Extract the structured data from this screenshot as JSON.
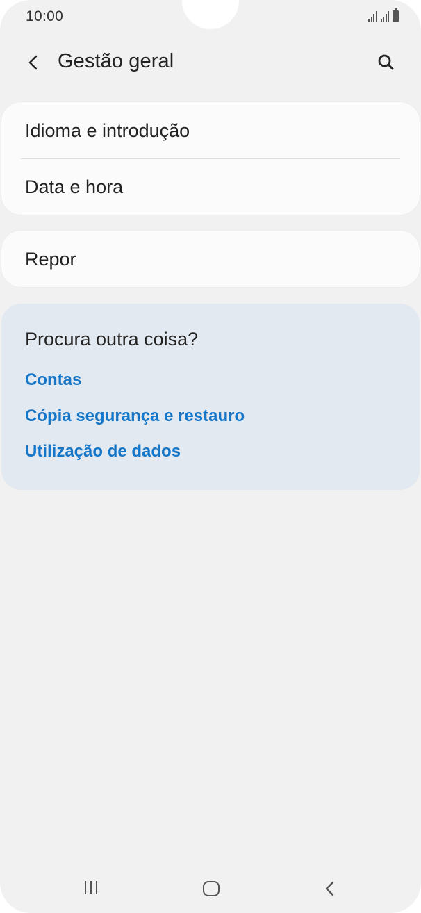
{
  "status_bar": {
    "time": "10:00",
    "icons": [
      "signal-icon",
      "signal-icon",
      "battery-icon"
    ]
  },
  "header": {
    "title": "Gestão geral",
    "back_icon": "back-arrow-icon",
    "search_icon": "search-icon"
  },
  "settings": {
    "group1": [
      {
        "label": "Idioma e introdução"
      },
      {
        "label": "Data e hora"
      }
    ],
    "group2": [
      {
        "label": "Repor"
      }
    ]
  },
  "suggestions": {
    "title": "Procura outra coisa?",
    "links": [
      {
        "label": "Contas"
      },
      {
        "label": "Cópia segurança e restauro"
      },
      {
        "label": "Utilização de dados"
      }
    ]
  },
  "nav_bar": {
    "recents_icon": "recents-icon",
    "home_icon": "home-icon",
    "back_icon": "back-icon"
  },
  "colors": {
    "background": "#f1f1f1",
    "card": "#fbfbfb",
    "suggestion_card": "#e3e9f0",
    "link": "#1677c9",
    "text": "#222222"
  }
}
